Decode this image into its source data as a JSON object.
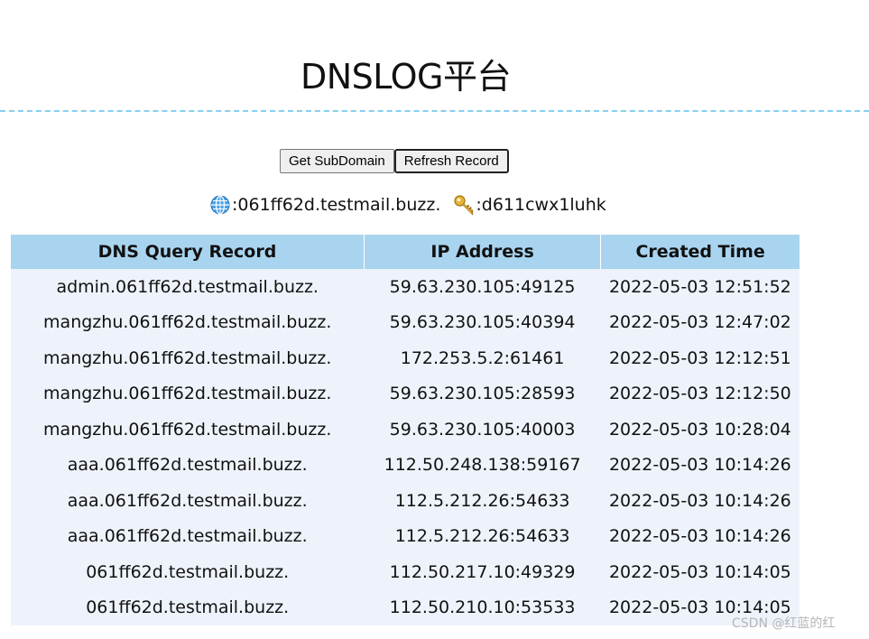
{
  "page": {
    "title": "DNSLOG平台"
  },
  "toolbar": {
    "get_subdomain_label": "Get SubDomain",
    "refresh_record_label": "Refresh Record"
  },
  "info": {
    "domain_icon": "globe-icon",
    "domain_text": ":061ff62d.testmail.buzz.",
    "token_icon": "key-icon",
    "token_text": ":d611cwx1luhk"
  },
  "table": {
    "headers": [
      "DNS Query Record",
      "IP Address",
      "Created Time"
    ],
    "rows": [
      [
        "admin.061ff62d.testmail.buzz.",
        "59.63.230.105:49125",
        "2022-05-03 12:51:52"
      ],
      [
        "mangzhu.061ff62d.testmail.buzz.",
        "59.63.230.105:40394",
        "2022-05-03 12:47:02"
      ],
      [
        "mangzhu.061ff62d.testmail.buzz.",
        "172.253.5.2:61461",
        "2022-05-03 12:12:51"
      ],
      [
        "mangzhu.061ff62d.testmail.buzz.",
        "59.63.230.105:28593",
        "2022-05-03 12:12:50"
      ],
      [
        "mangzhu.061ff62d.testmail.buzz.",
        "59.63.230.105:40003",
        "2022-05-03 10:28:04"
      ],
      [
        "aaa.061ff62d.testmail.buzz.",
        "112.50.248.138:59167",
        "2022-05-03 10:14:26"
      ],
      [
        "aaa.061ff62d.testmail.buzz.",
        "112.5.212.26:54633",
        "2022-05-03 10:14:26"
      ],
      [
        "aaa.061ff62d.testmail.buzz.",
        "112.5.212.26:54633",
        "2022-05-03 10:14:26"
      ],
      [
        "061ff62d.testmail.buzz.",
        "112.50.217.10:49329",
        "2022-05-03 10:14:05"
      ],
      [
        "061ff62d.testmail.buzz.",
        "112.50.210.10:53533",
        "2022-05-03 10:14:05"
      ]
    ]
  },
  "watermark": {
    "text": "CSDN @红蓝的红"
  },
  "colors": {
    "header_bg": "#a9d4ef",
    "table_bg": "#eef3fb",
    "divider": "#87cef0"
  }
}
